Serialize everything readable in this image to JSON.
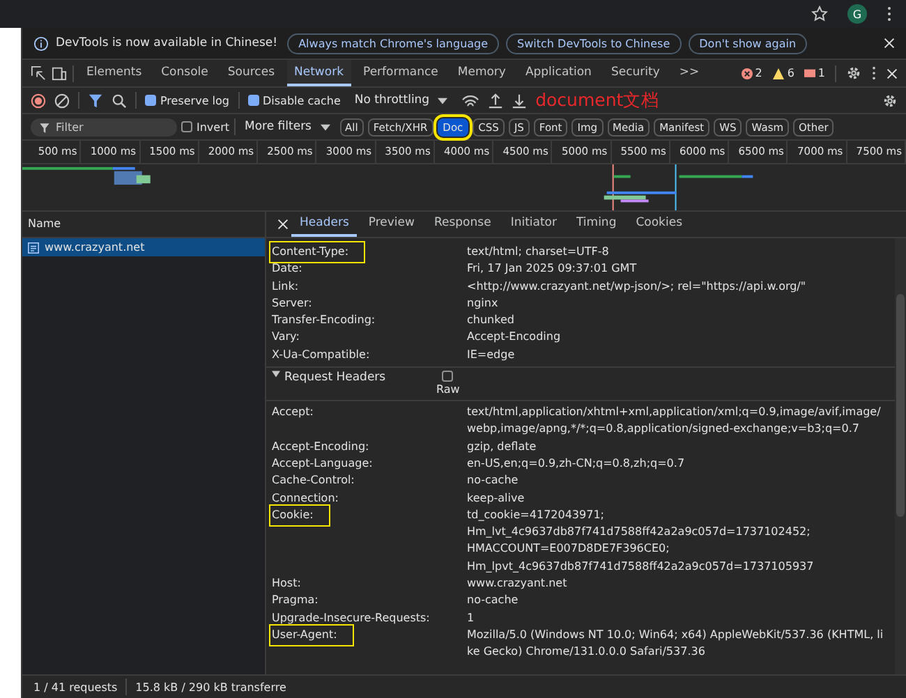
{
  "browser": {
    "avatar_letter": "G"
  },
  "infobar": {
    "message": "DevTools is now available in Chinese!",
    "buttons": [
      "Always match Chrome's language",
      "Switch DevTools to Chinese",
      "Don't show again"
    ]
  },
  "tabs": [
    {
      "label": "Elements",
      "selected": false
    },
    {
      "label": "Console",
      "selected": false
    },
    {
      "label": "Sources",
      "selected": false
    },
    {
      "label": "Network",
      "selected": true
    },
    {
      "label": "Performance",
      "selected": false
    },
    {
      "label": "Memory",
      "selected": false
    },
    {
      "label": "Application",
      "selected": false
    },
    {
      "label": "Security",
      "selected": false
    },
    {
      "label": ">>",
      "selected": false
    }
  ],
  "issue_counts": {
    "errors": "2",
    "warnings": "6",
    "issues": "1"
  },
  "toolbar": {
    "preserve_log": {
      "label": "Preserve log",
      "checked": true
    },
    "disable_cache": {
      "label": "Disable cache",
      "checked": true
    },
    "throttling": "No throttling",
    "annotation": "document文档"
  },
  "filter_bar": {
    "placeholder": "Filter",
    "invert": {
      "label": "Invert",
      "checked": false
    },
    "more_filters": "More filters",
    "types": [
      {
        "label": "All",
        "selected": false,
        "highlighted": false
      },
      {
        "label": "Fetch/XHR",
        "selected": false,
        "highlighted": false
      },
      {
        "label": "Doc",
        "selected": true,
        "highlighted": true
      },
      {
        "label": "CSS",
        "selected": false,
        "highlighted": false
      },
      {
        "label": "JS",
        "selected": false,
        "highlighted": false
      },
      {
        "label": "Font",
        "selected": false,
        "highlighted": false
      },
      {
        "label": "Img",
        "selected": false,
        "highlighted": false
      },
      {
        "label": "Media",
        "selected": false,
        "highlighted": false
      },
      {
        "label": "Manifest",
        "selected": false,
        "highlighted": false
      },
      {
        "label": "WS",
        "selected": false,
        "highlighted": false
      },
      {
        "label": "Wasm",
        "selected": false,
        "highlighted": false
      },
      {
        "label": "Other",
        "selected": false,
        "highlighted": false
      }
    ]
  },
  "timeline": {
    "ticks": [
      "500 ms",
      "1000 ms",
      "1500 ms",
      "2000 ms",
      "2500 ms",
      "3000 ms",
      "3500 ms",
      "4000 ms",
      "4500 ms",
      "5000 ms",
      "5500 ms",
      "6000 ms",
      "6500 ms",
      "7000 ms",
      "7500 ms"
    ]
  },
  "requests": {
    "column": "Name",
    "rows": [
      {
        "name": "www.crazyant.net",
        "selected": true
      }
    ]
  },
  "detail_tabs": [
    {
      "label": "Headers",
      "selected": true
    },
    {
      "label": "Preview",
      "selected": false
    },
    {
      "label": "Response",
      "selected": false
    },
    {
      "label": "Initiator",
      "selected": false
    },
    {
      "label": "Timing",
      "selected": false
    },
    {
      "label": "Cookies",
      "selected": false
    }
  ],
  "response_headers": [
    {
      "name": "Content-Type:",
      "values": [
        "text/html; charset=UTF-8"
      ],
      "highlighted": true
    },
    {
      "name": "Date:",
      "values": [
        "Fri, 17 Jan 2025 09:37:01 GMT"
      ],
      "highlighted": false
    },
    {
      "name": "Link:",
      "values": [
        "<http://www.crazyant.net/wp-json/>; rel=\"https://api.w.org/\""
      ],
      "highlighted": false
    },
    {
      "name": "Server:",
      "values": [
        "nginx"
      ],
      "highlighted": false
    },
    {
      "name": "Transfer-Encoding:",
      "values": [
        "chunked"
      ],
      "highlighted": false
    },
    {
      "name": "Vary:",
      "values": [
        "Accept-Encoding"
      ],
      "highlighted": false
    },
    {
      "name": "X-Ua-Compatible:",
      "values": [
        "IE=edge"
      ],
      "highlighted": false
    }
  ],
  "request_headers": {
    "title": "Request Headers",
    "expanded": true,
    "raw": {
      "label": "Raw",
      "checked": false
    },
    "rows": [
      {
        "name": "Accept:",
        "values": [
          "text/html,application/xhtml+xml,application/xml;q=0.9,image/avif,image/webp,image/apng,*/*;q=0.8,application/signed-exchange;v=b3;q=0.7"
        ],
        "highlighted": false
      },
      {
        "name": "Accept-Encoding:",
        "values": [
          "gzip, deflate"
        ],
        "highlighted": false
      },
      {
        "name": "Accept-Language:",
        "values": [
          "en-US,en;q=0.9,zh-CN;q=0.8,zh;q=0.7"
        ],
        "highlighted": false
      },
      {
        "name": "Cache-Control:",
        "values": [
          "no-cache"
        ],
        "highlighted": false
      },
      {
        "name": "Connection:",
        "values": [
          "keep-alive"
        ],
        "highlighted": false
      },
      {
        "name": "Cookie:",
        "values": [
          "td_cookie=4172043971;",
          "Hm_lvt_4c9637db87f741d7588ff42a2a9c057d=1737102452;",
          "HMACCOUNT=E007D8DE7F396CE0;",
          "Hm_lpvt_4c9637db87f741d7588ff42a2a9c057d=1737105937"
        ],
        "highlighted": true
      },
      {
        "name": "Host:",
        "values": [
          "www.crazyant.net"
        ],
        "highlighted": false
      },
      {
        "name": "Pragma:",
        "values": [
          "no-cache"
        ],
        "highlighted": false
      },
      {
        "name": "Upgrade-Insecure-Requests:",
        "values": [
          "1"
        ],
        "highlighted": false
      },
      {
        "name": "User-Agent:",
        "values": [
          "Mozilla/5.0 (Windows NT 10.0; Win64; x64) AppleWebKit/537.36 (KHTML, like Gecko) Chrome/131.0.0.0 Safari/537.36"
        ],
        "highlighted": true
      }
    ]
  },
  "status_bar": {
    "requests": "1 / 41 requests",
    "transferred": "15.8 kB / 290 kB transferre"
  }
}
